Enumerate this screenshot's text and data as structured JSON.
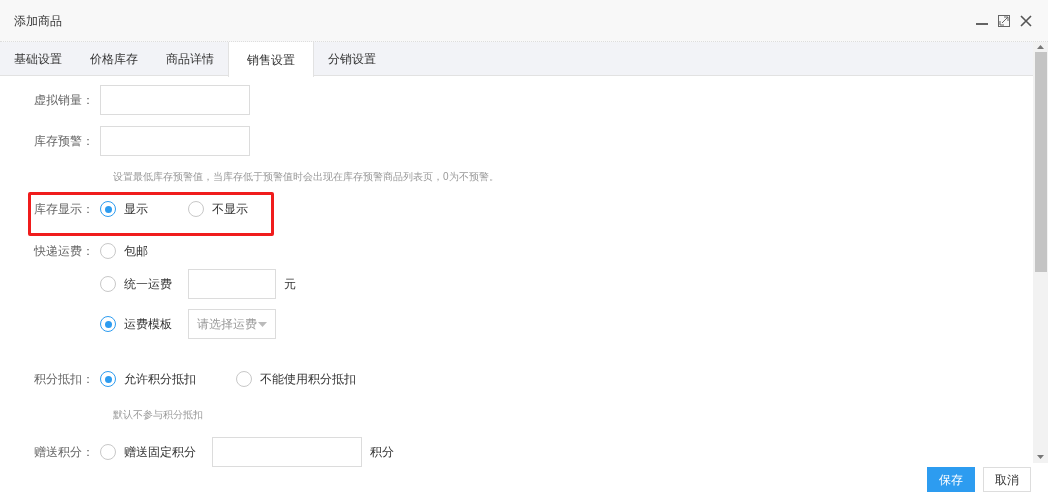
{
  "window": {
    "title": "添加商品"
  },
  "tabs": [
    {
      "label": "基础设置",
      "selected": false
    },
    {
      "label": "价格库存",
      "selected": false
    },
    {
      "label": "商品详情",
      "selected": false
    },
    {
      "label": "销售设置",
      "selected": true
    },
    {
      "label": "分销设置",
      "selected": false
    }
  ],
  "fields": [
    {
      "kind": "input",
      "label": "虚拟销量："
    },
    {
      "kind": "input",
      "label": "库存预警：",
      "hint": "设置最低库存预警值，当库存低于预警值时会出现在库存预警商品列表页，0为不预警。"
    },
    {
      "kind": "radio",
      "label": "库存显示：",
      "highlighted": true,
      "options": [
        {
          "label": "显示",
          "selected": true
        },
        {
          "label": "不显示",
          "selected": false
        }
      ]
    },
    {
      "kind": "radio_stack",
      "label": "快递运费：",
      "options": [
        {
          "label": "包邮",
          "selected": false
        },
        {
          "label": "统一运费",
          "selected": false,
          "suffix": "元",
          "kind": "input"
        },
        {
          "label": "运费模板",
          "selected": true,
          "kind": "select",
          "placeholder": "请选择运费"
        }
      ]
    },
    {
      "kind": "radio",
      "label": "积分抵扣：",
      "hint": "默认不参与积分抵扣",
      "options": [
        {
          "label": "允许积分抵扣",
          "selected": true
        },
        {
          "label": "不能使用积分抵扣",
          "selected": false
        }
      ]
    },
    {
      "kind": "radio",
      "label": "赠送积分：",
      "options": [
        {
          "label": "赠送固定积分",
          "selected": false,
          "kind": "input",
          "suffix": "积分"
        }
      ]
    }
  ],
  "buttons": [
    {
      "label": "保存",
      "kind": "primary"
    },
    {
      "label": "取消",
      "kind": "default"
    }
  ]
}
